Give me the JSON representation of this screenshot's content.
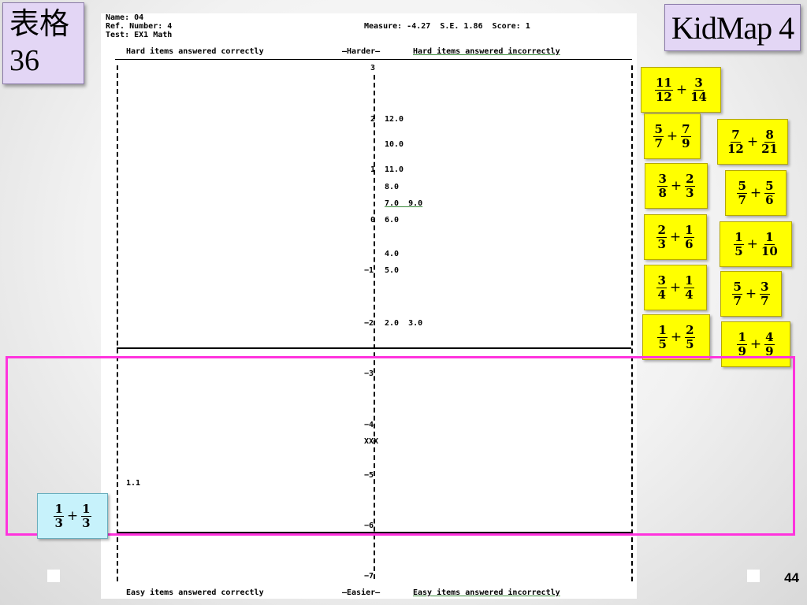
{
  "slide_title": "表格\n36",
  "kidmap_label": "KidMap 4",
  "page_number": "44",
  "header": {
    "name": "Name: 04",
    "ref": "Ref. Number: 4",
    "test": "Test: EX1 Math",
    "measure": "Measure: -4.27  S.E. 1.86  Score: 1"
  },
  "columns": {
    "top_left": "Hard items answered correctly",
    "top_mid": "—Harder—",
    "top_right": "Hard items answered incorrectly",
    "bottom_left": "Easy items answered correctly",
    "bottom_mid": "—Easier—",
    "bottom_right": "Easy items answered incorrectly"
  },
  "scale_ticks": [
    "3",
    "2",
    "1",
    "0",
    "−1",
    "−2",
    "−3",
    "−4",
    "−5",
    "−6",
    "−7"
  ],
  "items_incorrect": [
    "12.0",
    "10.0",
    "11.0",
    "8.0",
    "7.0  9.0",
    "6.0",
    "4.0",
    "5.0",
    "2.0  3.0"
  ],
  "items_correct": [
    "1.1"
  ],
  "person_marker": "XXX",
  "fractions": [
    {
      "a": [
        "11",
        "12"
      ],
      "b": [
        "3",
        "14"
      ],
      "op": "+"
    },
    {
      "a": [
        "5",
        "7"
      ],
      "b": [
        "7",
        "9"
      ],
      "op": "+"
    },
    {
      "a": [
        "7",
        "12"
      ],
      "b": [
        "8",
        "21"
      ],
      "op": "+"
    },
    {
      "a": [
        "3",
        "8"
      ],
      "b": [
        "2",
        "3"
      ],
      "op": "+"
    },
    {
      "a": [
        "5",
        "7"
      ],
      "b": [
        "5",
        "6"
      ],
      "op": "+"
    },
    {
      "a": [
        "2",
        "3"
      ],
      "b": [
        "1",
        "6"
      ],
      "op": "+"
    },
    {
      "a": [
        "1",
        "5"
      ],
      "b": [
        "1",
        "10"
      ],
      "op": "+"
    },
    {
      "a": [
        "3",
        "4"
      ],
      "b": [
        "1",
        "4"
      ],
      "op": "+"
    },
    {
      "a": [
        "5",
        "7"
      ],
      "b": [
        "3",
        "7"
      ],
      "op": "+"
    },
    {
      "a": [
        "1",
        "5"
      ],
      "b": [
        "2",
        "5"
      ],
      "op": "+"
    },
    {
      "a": [
        "1",
        "9"
      ],
      "b": [
        "4",
        "9"
      ],
      "op": "+"
    },
    {
      "a": [
        "1",
        "3"
      ],
      "b": [
        "1",
        "3"
      ],
      "op": "+"
    }
  ],
  "colors": {
    "fraction_yellow": "#ffff00",
    "fraction_blue": "#c7f2fb",
    "highlight": "#ff33dd",
    "title_box": "#e3d6f5"
  }
}
